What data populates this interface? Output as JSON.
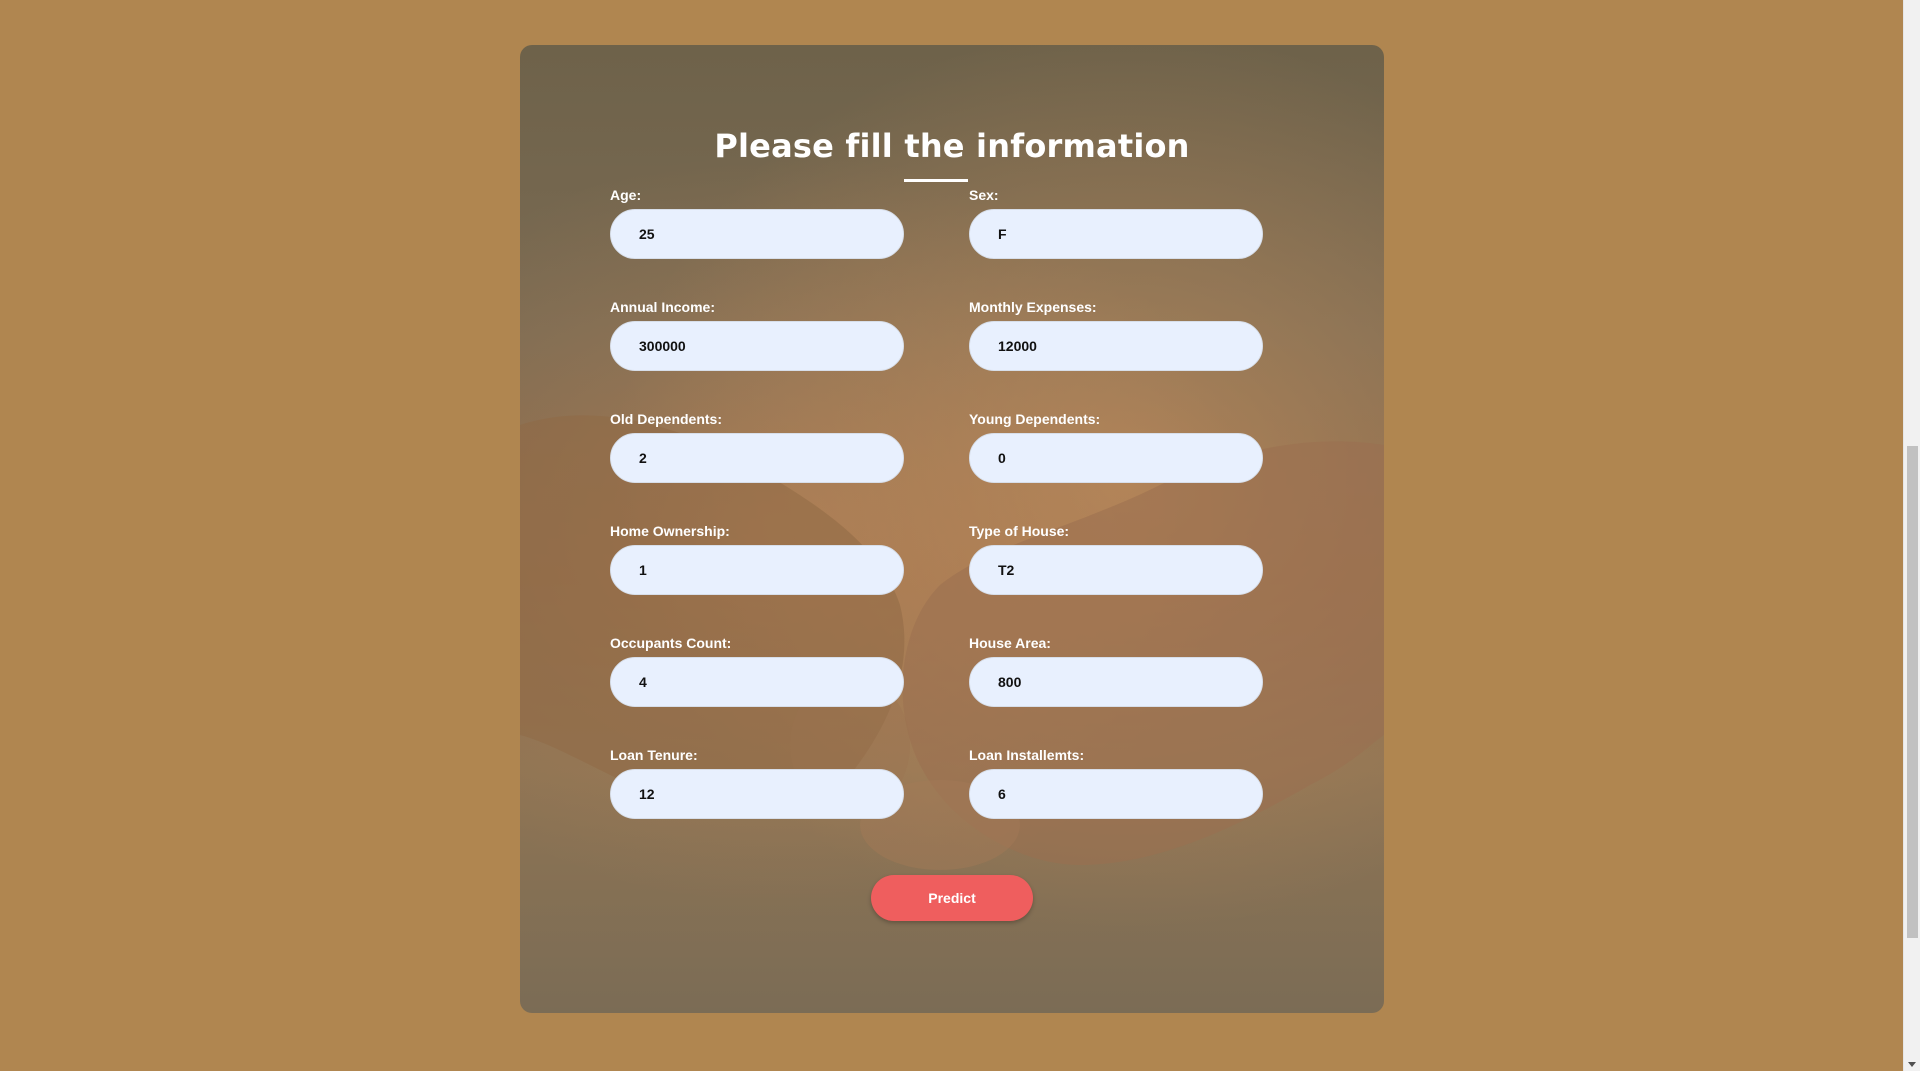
{
  "form": {
    "title": "Please fill the information",
    "fields": [
      {
        "label": "Age:",
        "value": "25"
      },
      {
        "label": "Sex:",
        "value": "F"
      },
      {
        "label": "Annual Income:",
        "value": "300000"
      },
      {
        "label": "Monthly Expenses:",
        "value": "12000"
      },
      {
        "label": "Old Dependents:",
        "value": "2"
      },
      {
        "label": "Young Dependents:",
        "value": "0"
      },
      {
        "label": "Home Ownership:",
        "value": "1"
      },
      {
        "label": "Type of House:",
        "value": "T2"
      },
      {
        "label": "Occupants Count:",
        "value": "4"
      },
      {
        "label": "House Area:",
        "value": "800"
      },
      {
        "label": "Loan Tenure:",
        "value": "12"
      },
      {
        "label": "Loan Installemts:",
        "value": "6"
      }
    ],
    "submit_label": "Predict"
  },
  "colors": {
    "page_background": "#b08650",
    "input_background": "#e8f0fe",
    "button_background": "#ef5e5e",
    "text": "#ffffff"
  },
  "icons": {
    "scroll_down": "chevron-down-icon"
  }
}
